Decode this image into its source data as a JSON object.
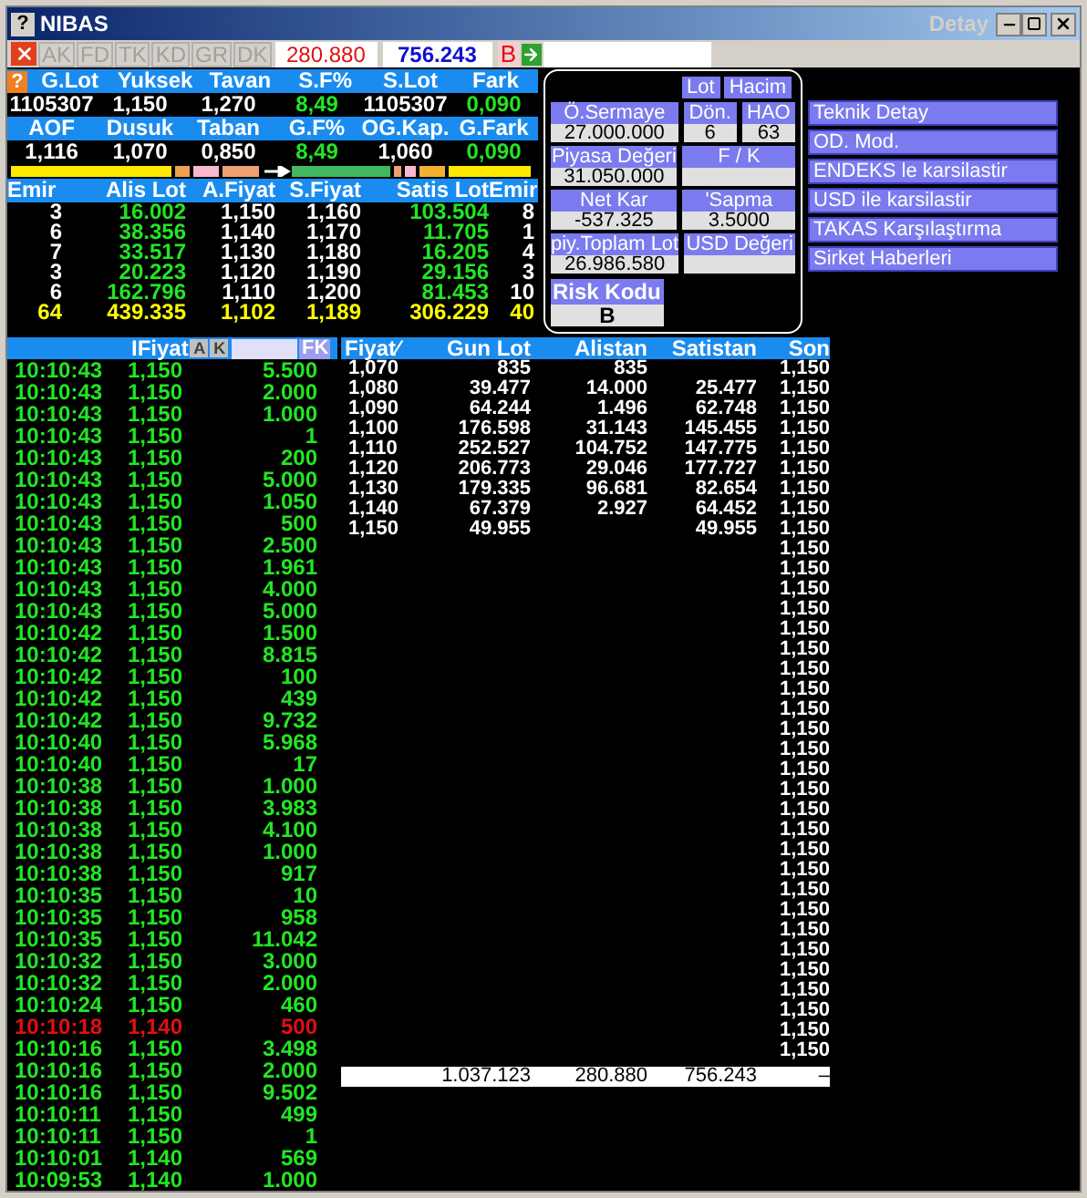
{
  "window": {
    "help": "?",
    "title": "NIBAS",
    "subtitle": "Detay"
  },
  "toolbar": {
    "tabs": [
      {
        "label": "AK",
        "disabled": true
      },
      {
        "label": "FD",
        "disabled": true
      },
      {
        "label": "TK",
        "disabled": true
      },
      {
        "label": "KD",
        "disabled": true
      },
      {
        "label": "GR",
        "disabled": true
      },
      {
        "label": "DK",
        "disabled": true
      }
    ],
    "buy_total": "280.880",
    "sell_total": "756.243",
    "flag": "B"
  },
  "summary": {
    "help": "?",
    "rows": [
      {
        "headers": [
          "G.Lot",
          "Yuksek",
          "Tavan",
          "S.F%",
          "S.Lot",
          "Fark"
        ],
        "values": [
          {
            "text": "1105307",
            "kind": "plain"
          },
          {
            "text": "1,150",
            "kind": "plain"
          },
          {
            "text": "1,270",
            "kind": "plain"
          },
          {
            "text": "8,49",
            "kind": "change"
          },
          {
            "text": "1105307",
            "kind": "plain"
          },
          {
            "text": "0,090",
            "kind": "change"
          }
        ]
      },
      {
        "headers": [
          "AOF",
          "Dusuk",
          "Taban",
          "G.F%",
          "OG.Kap.",
          "G.Fark"
        ],
        "values": [
          {
            "text": "1,116",
            "kind": "plain"
          },
          {
            "text": "1,070",
            "kind": "plain"
          },
          {
            "text": "0,850",
            "kind": "plain"
          },
          {
            "text": "8,49",
            "kind": "change"
          },
          {
            "text": "1,060",
            "kind": "plain"
          },
          {
            "text": "0,090",
            "kind": "change"
          }
        ]
      }
    ]
  },
  "order_book": {
    "columns": [
      "Emir",
      "Alis Lot",
      "A.Fiyat",
      "S.Fiyat",
      "Satis Lot",
      "Emir"
    ],
    "rows": [
      {
        "kind": "level",
        "cells": [
          "3",
          "16.002",
          "1,150",
          "1,160",
          "103.504",
          "8"
        ]
      },
      {
        "kind": "level",
        "cells": [
          "6",
          "38.356",
          "1,140",
          "1,170",
          "11.705",
          "1"
        ]
      },
      {
        "kind": "level",
        "cells": [
          "7",
          "33.517",
          "1,130",
          "1,180",
          "16.205",
          "4"
        ]
      },
      {
        "kind": "level",
        "cells": [
          "3",
          "20.223",
          "1,120",
          "1,190",
          "29.156",
          "3"
        ]
      },
      {
        "kind": "level",
        "cells": [
          "6",
          "162.796",
          "1,110",
          "1,200",
          "81.453",
          "10"
        ]
      },
      {
        "kind": "total",
        "cells": [
          "64",
          "439.335",
          "1,102",
          "1,189",
          "306.229",
          "40"
        ]
      }
    ]
  },
  "info_panel": {
    "buttons": [
      "Lot",
      "Hacim"
    ],
    "rows": [
      [
        {
          "label": "Ö.Sermaye",
          "value": "27.000.000"
        },
        {
          "label": "Dön.",
          "value": "6"
        },
        {
          "label": "HAO",
          "value": "63"
        }
      ],
      [
        {
          "label": "Piyasa Değeri",
          "value": "31.050.000"
        },
        {
          "label": "F / K"
        }
      ],
      [
        {
          "label": "Net Kar",
          "value": "-537.325"
        },
        {
          "label": "'Sapma",
          "value": "3.5000"
        }
      ],
      [
        {
          "label": "piy.Toplam Lot",
          "value": "26.986.580"
        },
        {
          "label": "USD Değeri"
        }
      ]
    ],
    "risk": {
      "label": "Risk Kodu",
      "value": "B"
    }
  },
  "links": [
    "Teknik Detay",
    "OD. Mod.",
    "ENDEKS le karsilastir",
    "USD ile karsilastir",
    "TAKAS Karşılaştırma",
    "Sirket Haberleri"
  ],
  "trades": {
    "column": "IFiyat",
    "buttons": [
      "A",
      "K"
    ],
    "filter_button": "FK",
    "rows": [
      {
        "time": "10:10:43",
        "price": "1,150",
        "lot": "5.500",
        "kind": "up"
      },
      {
        "time": "10:10:43",
        "price": "1,150",
        "lot": "2.000",
        "kind": "up"
      },
      {
        "time": "10:10:43",
        "price": "1,150",
        "lot": "1.000",
        "kind": "up"
      },
      {
        "time": "10:10:43",
        "price": "1,150",
        "lot": "1",
        "kind": "up"
      },
      {
        "time": "10:10:43",
        "price": "1,150",
        "lot": "200",
        "kind": "up"
      },
      {
        "time": "10:10:43",
        "price": "1,150",
        "lot": "5.000",
        "kind": "up"
      },
      {
        "time": "10:10:43",
        "price": "1,150",
        "lot": "1.050",
        "kind": "up"
      },
      {
        "time": "10:10:43",
        "price": "1,150",
        "lot": "500",
        "kind": "up"
      },
      {
        "time": "10:10:43",
        "price": "1,150",
        "lot": "2.500",
        "kind": "up"
      },
      {
        "time": "10:10:43",
        "price": "1,150",
        "lot": "1.961",
        "kind": "up"
      },
      {
        "time": "10:10:43",
        "price": "1,150",
        "lot": "4.000",
        "kind": "up"
      },
      {
        "time": "10:10:43",
        "price": "1,150",
        "lot": "5.000",
        "kind": "up"
      },
      {
        "time": "10:10:42",
        "price": "1,150",
        "lot": "1.500",
        "kind": "up"
      },
      {
        "time": "10:10:42",
        "price": "1,150",
        "lot": "8.815",
        "kind": "up"
      },
      {
        "time": "10:10:42",
        "price": "1,150",
        "lot": "100",
        "kind": "up"
      },
      {
        "time": "10:10:42",
        "price": "1,150",
        "lot": "439",
        "kind": "up"
      },
      {
        "time": "10:10:42",
        "price": "1,150",
        "lot": "9.732",
        "kind": "up"
      },
      {
        "time": "10:10:40",
        "price": "1,150",
        "lot": "5.968",
        "kind": "up"
      },
      {
        "time": "10:10:40",
        "price": "1,150",
        "lot": "17",
        "kind": "up"
      },
      {
        "time": "10:10:38",
        "price": "1,150",
        "lot": "1.000",
        "kind": "up"
      },
      {
        "time": "10:10:38",
        "price": "1,150",
        "lot": "3.983",
        "kind": "up"
      },
      {
        "time": "10:10:38",
        "price": "1,150",
        "lot": "4.100",
        "kind": "up"
      },
      {
        "time": "10:10:38",
        "price": "1,150",
        "lot": "1.000",
        "kind": "up"
      },
      {
        "time": "10:10:38",
        "price": "1,150",
        "lot": "917",
        "kind": "up"
      },
      {
        "time": "10:10:35",
        "price": "1,150",
        "lot": "10",
        "kind": "up"
      },
      {
        "time": "10:10:35",
        "price": "1,150",
        "lot": "958",
        "kind": "up"
      },
      {
        "time": "10:10:35",
        "price": "1,150",
        "lot": "11.042",
        "kind": "up"
      },
      {
        "time": "10:10:32",
        "price": "1,150",
        "lot": "3.000",
        "kind": "up"
      },
      {
        "time": "10:10:32",
        "price": "1,150",
        "lot": "2.000",
        "kind": "up"
      },
      {
        "time": "10:10:24",
        "price": "1,150",
        "lot": "460",
        "kind": "up"
      },
      {
        "time": "10:10:18",
        "price": "1,140",
        "lot": "500",
        "kind": "down"
      },
      {
        "time": "10:10:16",
        "price": "1,150",
        "lot": "3.498",
        "kind": "up"
      },
      {
        "time": "10:10:16",
        "price": "1,150",
        "lot": "2.000",
        "kind": "up"
      },
      {
        "time": "10:10:16",
        "price": "1,150",
        "lot": "9.502",
        "kind": "up"
      },
      {
        "time": "10:10:11",
        "price": "1,150",
        "lot": "499",
        "kind": "up"
      },
      {
        "time": "10:10:11",
        "price": "1,150",
        "lot": "1",
        "kind": "up"
      },
      {
        "time": "10:10:01",
        "price": "1,140",
        "lot": "569",
        "kind": "up"
      },
      {
        "time": "10:09:53",
        "price": "1,140",
        "lot": "1.000",
        "kind": "up"
      }
    ]
  },
  "price_table": {
    "columns": [
      "Fiyat⁄",
      "Gun Lot",
      "Alistan",
      "Satistan",
      "Son"
    ],
    "rows": [
      {
        "price": "1,070",
        "day_lot": "835",
        "bought": "835",
        "last": "1,150"
      },
      {
        "price": "1,080",
        "day_lot": "39.477",
        "bought": "14.000",
        "sold": "25.477",
        "last": "1,150"
      },
      {
        "price": "1,090",
        "day_lot": "64.244",
        "bought": "1.496",
        "sold": "62.748",
        "last": "1,150"
      },
      {
        "price": "1,100",
        "day_lot": "176.598",
        "bought": "31.143",
        "sold": "145.455",
        "last": "1,150"
      },
      {
        "price": "1,110",
        "day_lot": "252.527",
        "bought": "104.752",
        "sold": "147.775",
        "last": "1,150"
      },
      {
        "price": "1,120",
        "day_lot": "206.773",
        "bought": "29.046",
        "sold": "177.727",
        "last": "1,150"
      },
      {
        "price": "1,130",
        "day_lot": "179.335",
        "bought": "96.681",
        "sold": "82.654",
        "last": "1,150"
      },
      {
        "price": "1,140",
        "day_lot": "67.379",
        "bought": "2.927",
        "sold": "64.452",
        "last": "1,150"
      },
      {
        "price": "1,150",
        "day_lot": "49.955",
        "sold": "49.955",
        "last": "1,150"
      },
      {
        "last": "1,150"
      },
      {
        "last": "1,150"
      },
      {
        "last": "1,150"
      },
      {
        "last": "1,150"
      },
      {
        "last": "1,150"
      },
      {
        "last": "1,150"
      },
      {
        "last": "1,150"
      },
      {
        "last": "1,150"
      },
      {
        "last": "1,150"
      },
      {
        "last": "1,150"
      },
      {
        "last": "1,150"
      },
      {
        "last": "1,150"
      },
      {
        "last": "1,150"
      },
      {
        "last": "1,150"
      },
      {
        "last": "1,150"
      },
      {
        "last": "1,150"
      },
      {
        "last": "1,150"
      },
      {
        "last": "1,150"
      },
      {
        "last": "1,150"
      },
      {
        "last": "1,150"
      },
      {
        "last": "1,150"
      },
      {
        "last": "1,150"
      },
      {
        "last": "1,150"
      },
      {
        "last": "1,150"
      },
      {
        "last": "1,150"
      },
      {
        "last": "1,150"
      }
    ],
    "totals": {
      "day_lot": "1.037.123",
      "bought": "280.880",
      "sold": "756.243",
      "last": "–"
    }
  }
}
